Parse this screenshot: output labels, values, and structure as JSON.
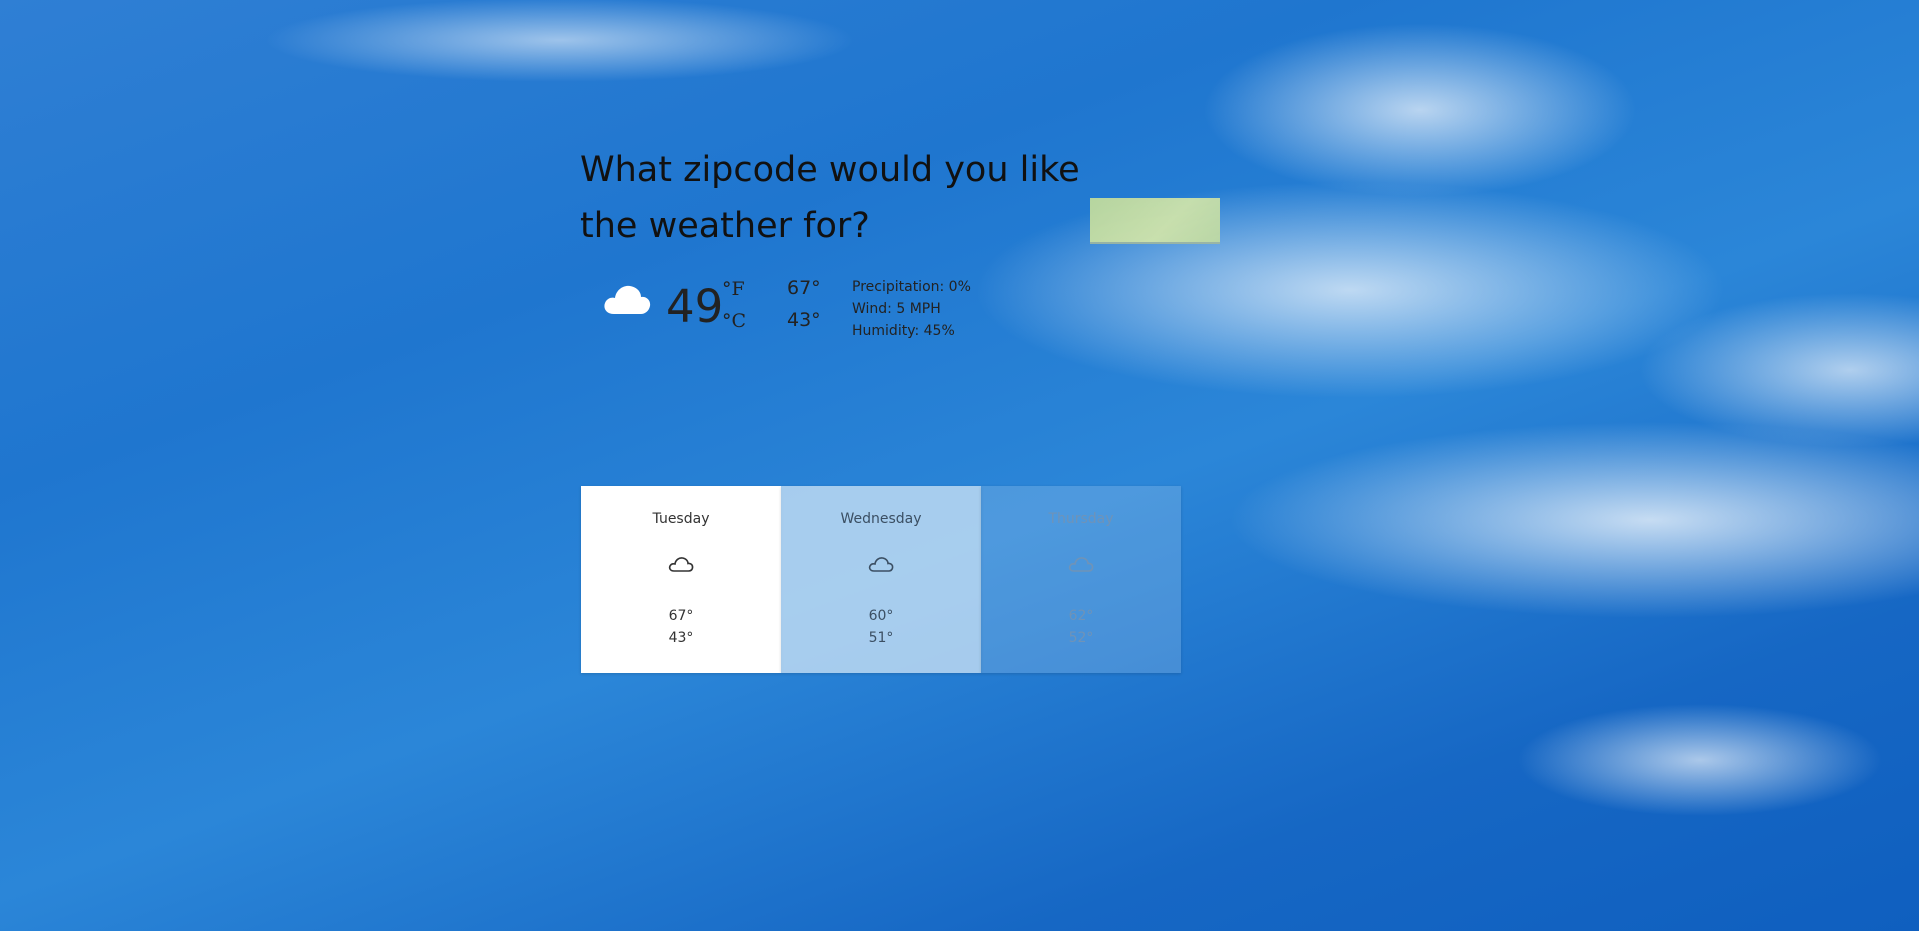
{
  "prompt": {
    "question": "What zipcode would you like the weather for?",
    "zip_value": ""
  },
  "current": {
    "icon": "cloud-icon",
    "temperature": "49",
    "unit_f": "°F",
    "unit_c": "°C",
    "high": "67°",
    "low": "43°",
    "precipitation": "Precipitation: 0%",
    "wind": "Wind: 5 MPH",
    "humidity": "Humidity: 45%"
  },
  "forecast": [
    {
      "day": "Tuesday",
      "icon": "cloud-outline-icon",
      "high": "67°",
      "low": "43°"
    },
    {
      "day": "Wednesday",
      "icon": "cloud-outline-icon",
      "high": "60°",
      "low": "51°"
    },
    {
      "day": "Thursday",
      "icon": "cloud-outline-icon",
      "high": "62°",
      "low": "52°"
    }
  ],
  "colors": {
    "sky": "#1f76cf",
    "input_fill": "#d6e8a9",
    "card_active": "#ffffff"
  }
}
